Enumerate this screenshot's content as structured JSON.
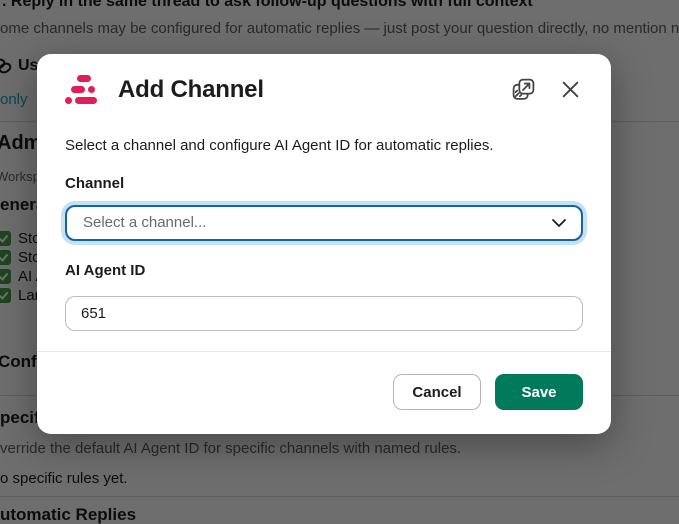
{
  "backdrop": {
    "thread_tip": ". Reply in the same thread to ask follow-up questions with full context",
    "auto_reply_note": "ome channels may be configured for automatic replies — just post your question directly, no mention needed.",
    "useful_links_heading": "Us",
    "channel_link": "only",
    "admin_heading": "Admin",
    "workspace_label": "Worksp",
    "general_heading": "enera",
    "checklist": [
      "Sto",
      "Sto",
      "AI A",
      "Lan"
    ],
    "config_heading": "Confi",
    "specific_rules_heading": "pecifi",
    "specific_rules_desc": "verride the default AI Agent ID for specific channels with named rules.",
    "no_rules_text": "o specific rules yet.",
    "automatic_replies_heading": "utomatic Replies"
  },
  "modal": {
    "title": "Add Channel",
    "description": "Select a channel and configure AI Agent ID for automatic replies.",
    "channel_field": {
      "label": "Channel",
      "placeholder": "Select a channel..."
    },
    "agent_field": {
      "label": "AI Agent ID",
      "value": "651"
    },
    "buttons": {
      "cancel": "Cancel",
      "save": "Save"
    }
  },
  "icons": {
    "open_external": "popout-window ↗",
    "close": "×",
    "chevron_down": "⌄",
    "checkmark": "✓",
    "link": "🔗"
  },
  "colors": {
    "accent_pink": "#E01E5A",
    "save_green": "#007A5A",
    "focus_border": "#1264A3",
    "focus_ring": "#C7E0F2",
    "link_blue": "#1D9BD1",
    "check_green": "#43A047",
    "overlay": "rgba(0,0,0,0.57)"
  }
}
